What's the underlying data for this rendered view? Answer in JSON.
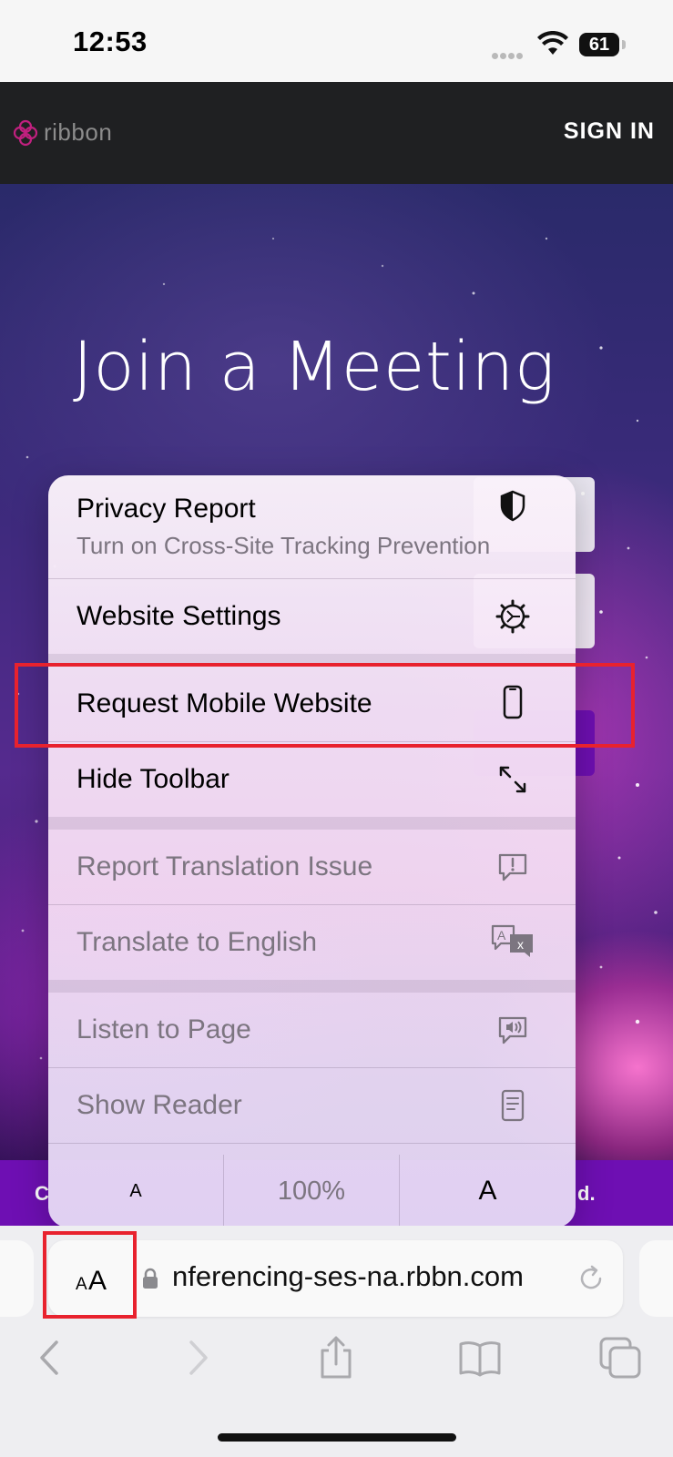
{
  "status_bar": {
    "time": "12:53",
    "battery": "61"
  },
  "site": {
    "brand": "ribbon",
    "signin_label": "SIGN IN",
    "hero_title": "Join a Meeting",
    "footer_left_fragment": "C",
    "footer_right_fragment": "d."
  },
  "menu": {
    "privacy_report": {
      "label": "Privacy Report",
      "sublabel": "Turn on Cross-Site Tracking Prevention",
      "icon": "shield-icon"
    },
    "website_settings": {
      "label": "Website Settings",
      "icon": "gear-icon"
    },
    "request_mobile": {
      "label": "Request Mobile Website",
      "icon": "phone-icon"
    },
    "hide_toolbar": {
      "label": "Hide Toolbar",
      "icon": "expand-arrows-icon"
    },
    "report_translation": {
      "label": "Report Translation Issue",
      "icon": "exclamation-bubble-icon"
    },
    "translate": {
      "label": "Translate to English",
      "icon": "translate-icon"
    },
    "listen": {
      "label": "Listen to Page",
      "icon": "speaker-bubble-icon"
    },
    "show_reader": {
      "label": "Show Reader",
      "icon": "reader-icon"
    },
    "zoom": {
      "smaller": "A",
      "level": "100%",
      "larger": "A"
    }
  },
  "address_bar": {
    "aa_small": "A",
    "aa_large": "A",
    "url": "nferencing-ses-na.rbbn.com"
  },
  "colors": {
    "highlight": "#e8222e",
    "brand_purple": "#6e0fb3",
    "header_bg": "#1f2022"
  }
}
